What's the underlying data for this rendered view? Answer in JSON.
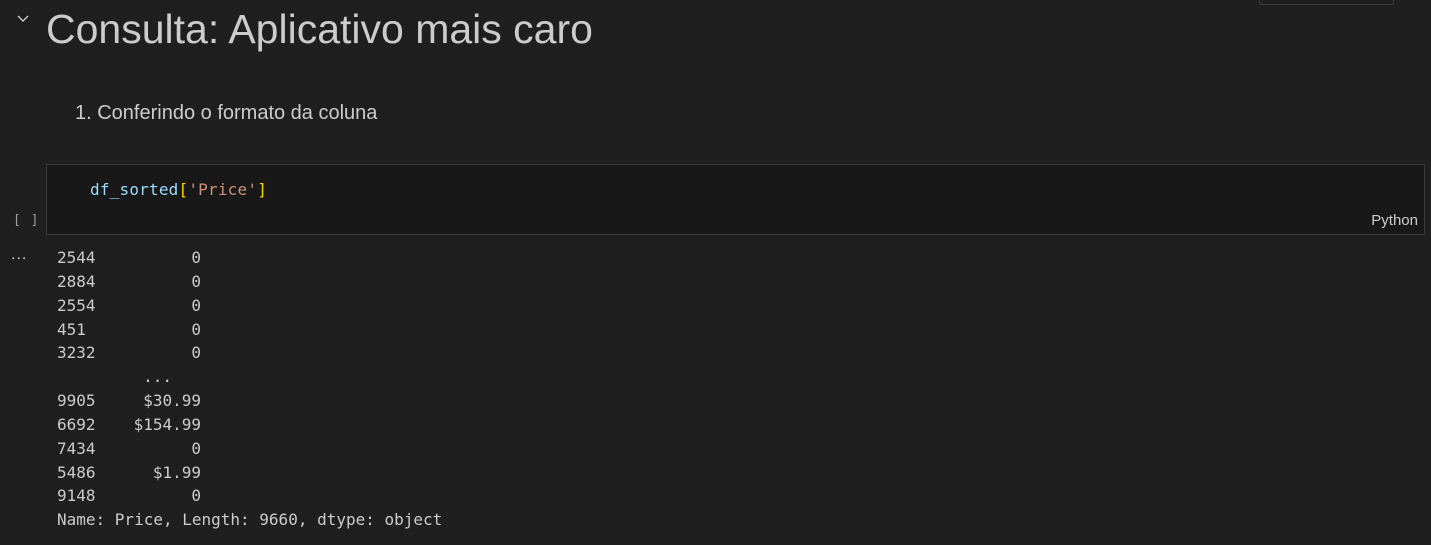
{
  "header": {
    "title": "Consulta: Aplicativo mais caro"
  },
  "markdown": {
    "list_items": [
      "1. Conferindo o formato da coluna"
    ]
  },
  "code_cell": {
    "code_var": "df_sorted",
    "code_open": "[",
    "code_str": "'Price'",
    "code_close": "]",
    "language": "Python",
    "execution_count": "[ ]"
  },
  "output": {
    "more_label": "...",
    "rows": [
      {
        "index": "2544",
        "value": "0"
      },
      {
        "index": "2884",
        "value": "0"
      },
      {
        "index": "2554",
        "value": "0"
      },
      {
        "index": "451",
        "value": "0"
      },
      {
        "index": "3232",
        "value": "0"
      }
    ],
    "ellipsis": "...",
    "rows_tail": [
      {
        "index": "9905",
        "value": "$30.99"
      },
      {
        "index": "6692",
        "value": "$154.99"
      },
      {
        "index": "7434",
        "value": "0"
      },
      {
        "index": "5486",
        "value": "$1.99"
      },
      {
        "index": "9148",
        "value": "0"
      }
    ],
    "summary": "Name: Price, Length: 9660, dtype: object"
  }
}
